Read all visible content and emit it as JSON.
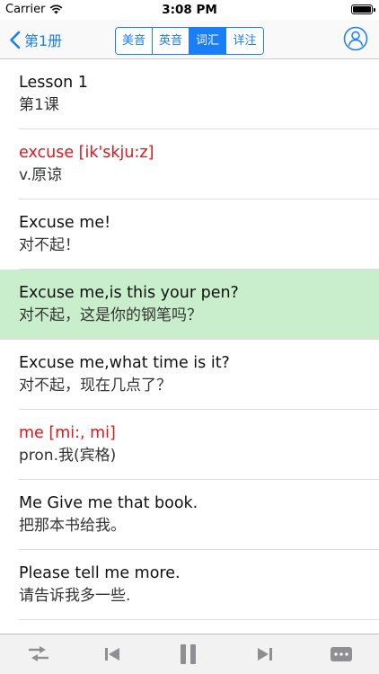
{
  "status_bar": {
    "carrier": "Carrier",
    "time": "3:08 PM",
    "wifi_icon": "wifi-icon",
    "battery_icon": "battery-icon"
  },
  "nav": {
    "back_label": "第1册",
    "back_icon": "chevron-left-icon",
    "tabs": [
      {
        "label": "美音",
        "active": false
      },
      {
        "label": "英音",
        "active": false
      },
      {
        "label": "词汇",
        "active": true
      },
      {
        "label": "详注",
        "active": false
      }
    ],
    "profile_icon": "user-circle-icon",
    "accent_color": "#1a7ef6"
  },
  "list": {
    "highlight_color": "#c9eecb",
    "vocab_color": "#e0161c",
    "items": [
      {
        "en": "Lesson 1",
        "zh": "第1课"
      },
      {
        "en": "excuse [ik'skju:z]",
        "zh": "v.原谅"
      },
      {
        "en": "Excuse me!",
        "zh": "对不起！"
      },
      {
        "en": "Excuse me,is this your pen?",
        "zh": "对不起，这是你的钢笔吗？"
      },
      {
        "en": "Excuse me,what time is it?",
        "zh": "对不起，现在几点了？"
      },
      {
        "en": "me [mi:, mi]",
        "zh": "pron.我(宾格)"
      },
      {
        "en": "Me Give me that book.",
        "zh": "把那本书给我。"
      },
      {
        "en": "Please tell me more.",
        "zh": "请告诉我多一些."
      }
    ]
  },
  "toolbar": {
    "icons": [
      "shuffle-icon",
      "previous-icon",
      "pause-icon",
      "next-icon",
      "more-icon"
    ]
  }
}
